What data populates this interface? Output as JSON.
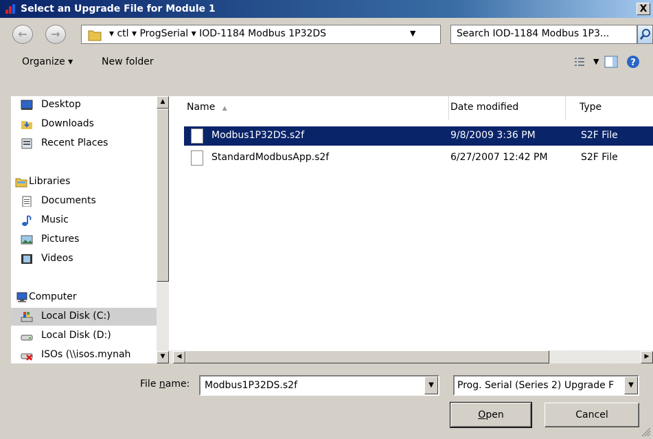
{
  "window": {
    "title": "Select an Upgrade File for Module 1",
    "close_glyph": "X"
  },
  "address": {
    "crumbs": "▾ ctl ▾ ProgSerial ▾ IOD-1184 Modbus 1P32DS",
    "search_placeholder": "Search IOD-1184 Modbus 1P3..."
  },
  "toolbar": {
    "organize": "Organize ▾",
    "new_folder": "New folder"
  },
  "nav": {
    "items": [
      {
        "label": "Desktop"
      },
      {
        "label": "Downloads"
      },
      {
        "label": "Recent Places"
      },
      {
        "label": "Libraries"
      },
      {
        "label": "Documents"
      },
      {
        "label": "Music"
      },
      {
        "label": "Pictures"
      },
      {
        "label": "Videos"
      },
      {
        "label": "Computer"
      },
      {
        "label": "Local Disk (C:)"
      },
      {
        "label": "Local Disk (D:)"
      },
      {
        "label": "ISOs (\\\\isos.mynah"
      }
    ]
  },
  "files": {
    "columns": {
      "name": "Name",
      "date": "Date modified",
      "type": "Type"
    },
    "rows": [
      {
        "name": "Modbus1P32DS.s2f",
        "date": "9/8/2009 3:36 PM",
        "type": "S2F File"
      },
      {
        "name": "StandardModbusApp.s2f",
        "date": "6/27/2007 12:42 PM",
        "type": "S2F File"
      }
    ]
  },
  "footer": {
    "filename_label_pre": "File ",
    "filename_label_key": "n",
    "filename_label_post": "ame:",
    "filename_value": "Modbus1P32DS.s2f",
    "filetype_value": "Prog. Serial (Series 2) Upgrade F",
    "open_key": "O",
    "open_rest": "pen",
    "cancel": "Cancel"
  },
  "colors": {
    "selection": "#0a246a",
    "title_start": "#0a246a",
    "title_end": "#a6caf0"
  }
}
